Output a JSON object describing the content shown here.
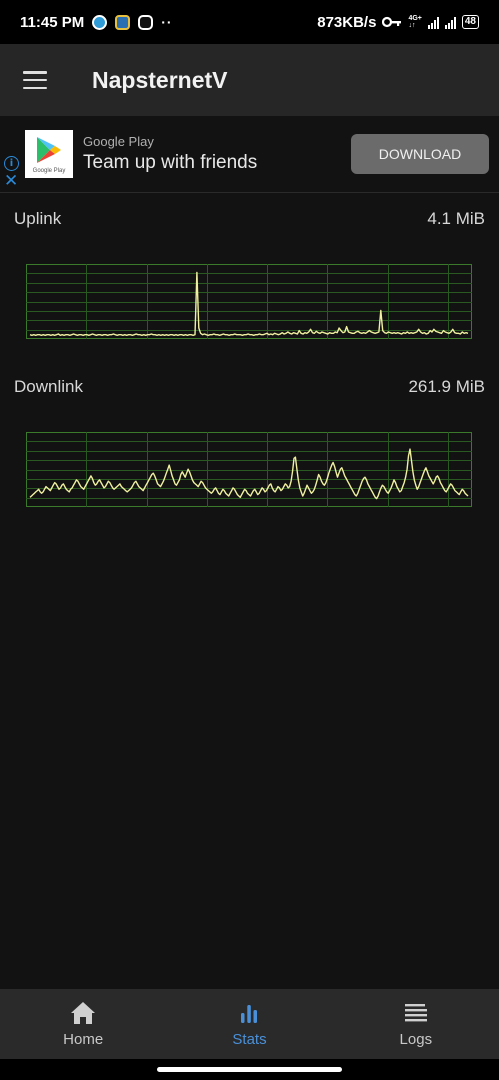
{
  "status_bar": {
    "time": "11:45 PM",
    "notification_icons": [
      "app-icon-1",
      "app-icon-2",
      "nv-icon"
    ],
    "more": "··",
    "network_speed": "873KB/s",
    "vpn_icon": "key-icon",
    "network_type": "4G+",
    "battery": "48"
  },
  "app_bar": {
    "title": "NapsternetV",
    "menu_icon": "hamburger-menu-icon"
  },
  "ad": {
    "source": "Google Play",
    "headline": "Team up with friends",
    "button_label": "DOWNLOAD",
    "logo_caption": "Google Play"
  },
  "stats": {
    "uplink": {
      "label": "Uplink",
      "value": "4.1 MiB",
      "series": [
        2,
        1,
        2,
        1,
        2,
        2,
        1,
        2,
        1,
        2,
        2,
        1,
        2,
        1,
        2,
        3,
        1,
        2,
        1,
        2,
        2,
        1,
        2,
        3,
        2,
        1,
        2,
        2,
        1,
        2,
        2,
        1,
        2,
        3,
        2,
        1,
        2,
        2,
        1,
        2,
        2,
        1,
        2,
        2,
        3,
        2,
        1,
        2,
        2,
        1,
        2,
        1,
        2,
        2,
        1,
        2,
        3,
        2,
        2,
        1,
        2,
        1,
        2,
        2,
        3,
        2,
        2,
        1,
        2,
        1,
        2,
        1,
        2,
        1,
        2,
        2,
        1,
        2,
        1,
        2,
        2,
        1,
        2,
        1,
        2,
        2,
        1,
        2,
        95,
        12,
        4,
        2,
        3,
        2,
        1,
        2,
        2,
        3,
        2,
        2,
        1,
        2,
        3,
        2,
        2,
        1,
        2,
        2,
        3,
        2,
        2,
        2,
        1,
        2,
        2,
        3,
        2,
        2,
        1,
        2,
        2,
        3,
        2,
        2,
        3,
        4,
        2,
        3,
        2,
        4,
        3,
        2,
        3,
        5,
        3,
        4,
        6,
        4,
        3,
        5,
        4,
        3,
        8,
        4,
        3,
        5,
        4,
        6,
        10,
        5,
        4,
        7,
        5,
        4,
        6,
        5,
        4,
        3,
        5,
        4,
        4,
        6,
        5,
        12,
        8,
        5,
        6,
        14,
        6,
        5,
        4,
        4,
        6,
        7,
        5,
        4,
        5,
        4,
        6,
        8,
        6,
        5,
        4,
        5,
        6,
        38,
        8,
        5,
        4,
        6,
        5,
        4,
        5,
        4,
        5,
        4,
        3,
        5,
        4,
        6,
        4,
        5,
        4,
        5,
        6,
        10,
        6,
        4,
        5,
        3,
        4,
        8,
        6,
        10,
        7,
        6,
        5,
        4,
        8,
        6,
        5,
        4,
        6,
        10,
        5,
        4,
        4,
        3,
        6,
        4,
        5,
        4
      ],
      "color": "#f0f0a0"
    },
    "downlink": {
      "label": "Downlink",
      "value": "261.9 MiB",
      "series": [
        10,
        12,
        14,
        16,
        18,
        20,
        22,
        18,
        16,
        18,
        22,
        26,
        24,
        22,
        20,
        24,
        28,
        32,
        30,
        26,
        22,
        24,
        28,
        30,
        26,
        22,
        20,
        18,
        22,
        24,
        28,
        32,
        36,
        34,
        30,
        26,
        24,
        22,
        26,
        30,
        34,
        38,
        42,
        38,
        32,
        28,
        30,
        34,
        36,
        32,
        28,
        24,
        26,
        30,
        34,
        32,
        28,
        24,
        22,
        24,
        26,
        28,
        30,
        26,
        24,
        22,
        20,
        18,
        20,
        22,
        24,
        28,
        32,
        34,
        30,
        26,
        24,
        22,
        20,
        24,
        28,
        32,
        36,
        40,
        44,
        46,
        42,
        36,
        30,
        28,
        26,
        30,
        34,
        40,
        46,
        52,
        58,
        50,
        42,
        36,
        30,
        28,
        32,
        36,
        44,
        48,
        44,
        40,
        46,
        52,
        48,
        42,
        36,
        32,
        30,
        28,
        26,
        30,
        34,
        32,
        28,
        24,
        22,
        20,
        18,
        16,
        18,
        22,
        24,
        20,
        16,
        14,
        18,
        22,
        20,
        16,
        14,
        12,
        16,
        20,
        24,
        22,
        18,
        14,
        12,
        10,
        14,
        18,
        22,
        20,
        16,
        14,
        12,
        16,
        20,
        22,
        18,
        14,
        16,
        20,
        24,
        22,
        18,
        20,
        24,
        28,
        30,
        24,
        20,
        18,
        22,
        26,
        24,
        20,
        22,
        26,
        30,
        28,
        24,
        26,
        34,
        48,
        68,
        70,
        52,
        36,
        24,
        18,
        12,
        16,
        22,
        28,
        24,
        20,
        16,
        18,
        22,
        28,
        36,
        44,
        40,
        34,
        30,
        28,
        32,
        38,
        46,
        52,
        58,
        62,
        56,
        48,
        40,
        46,
        52,
        54,
        48,
        42,
        38,
        34,
        30,
        26,
        22,
        18,
        14,
        12,
        16,
        22,
        28,
        34,
        38,
        40,
        36,
        30,
        26,
        22,
        18,
        14,
        10,
        8,
        12,
        18,
        24,
        28,
        26,
        22,
        18,
        16,
        20,
        24,
        30,
        36,
        32,
        26,
        22,
        18,
        20,
        26,
        32,
        40,
        52,
        72,
        82,
        66,
        48,
        36,
        28,
        22,
        26,
        32,
        38,
        44,
        50,
        54,
        48,
        42,
        38,
        34,
        30,
        34,
        40,
        42,
        38,
        32,
        28,
        24,
        20,
        18,
        22,
        26,
        30,
        28,
        24,
        20,
        18,
        16,
        14,
        18,
        22,
        20,
        16,
        14,
        12
      ],
      "color": "#f0f0a0"
    }
  },
  "bottom_nav": {
    "items": [
      {
        "label": "Home",
        "icon": "home-icon",
        "active": false
      },
      {
        "label": "Stats",
        "icon": "bar-chart-icon",
        "active": true
      },
      {
        "label": "Logs",
        "icon": "list-icon",
        "active": false
      }
    ],
    "active_color": "#4a90d9"
  }
}
